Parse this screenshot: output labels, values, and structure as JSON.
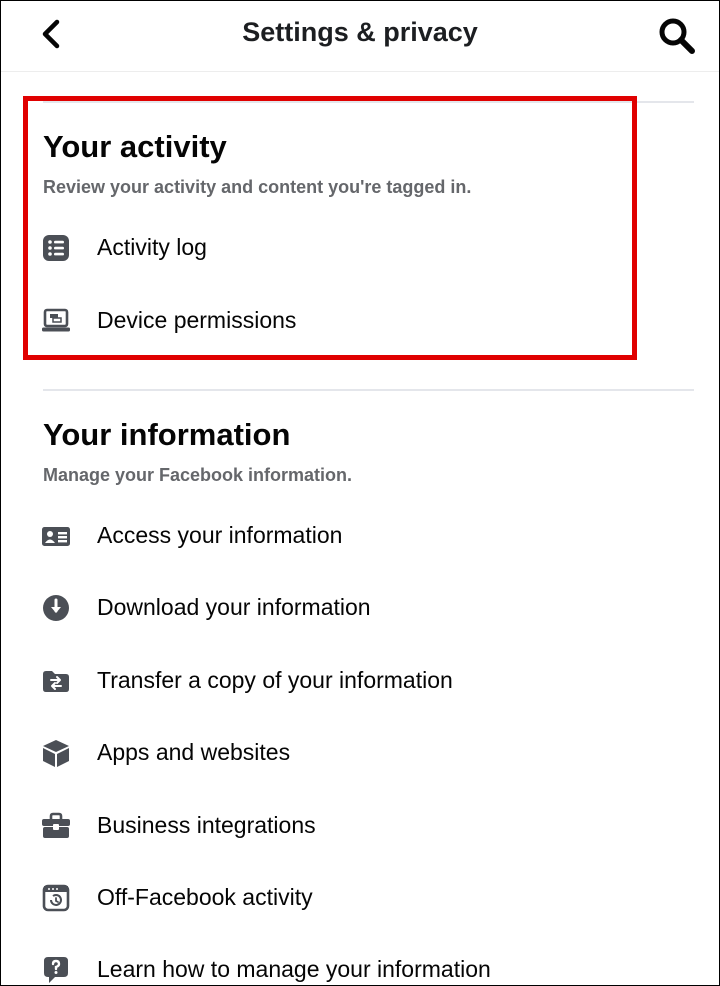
{
  "header": {
    "title": "Settings & privacy",
    "back_icon": "chevron-left-icon",
    "search_icon": "search-icon"
  },
  "your_activity": {
    "title": "Your activity",
    "subtitle": "Review your activity and content you're tagged in.",
    "items": [
      {
        "label": "Activity log",
        "icon": "list-icon"
      },
      {
        "label": "Device permissions",
        "icon": "laptop-icon"
      }
    ]
  },
  "your_information": {
    "title": "Your information",
    "subtitle": "Manage your Facebook information.",
    "items": [
      {
        "label": "Access your information",
        "icon": "id-card-icon"
      },
      {
        "label": "Download your information",
        "icon": "download-icon"
      },
      {
        "label": "Transfer a copy of your information",
        "icon": "folder-transfer-icon"
      },
      {
        "label": "Apps and websites",
        "icon": "cube-icon"
      },
      {
        "label": "Business integrations",
        "icon": "briefcase-icon"
      },
      {
        "label": "Off-Facebook activity",
        "icon": "calendar-history-icon"
      },
      {
        "label": "Learn how to manage your information",
        "icon": "help-bubble-icon"
      }
    ]
  },
  "colors": {
    "text": "#050505",
    "subtext": "#65676b",
    "icon": "#4b4f56",
    "highlight": "#e00000",
    "divider": "#e4e6eb"
  }
}
